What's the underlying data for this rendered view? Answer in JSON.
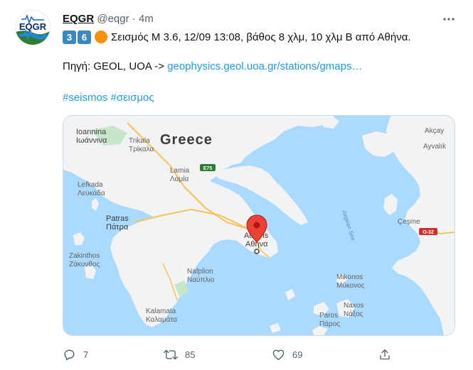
{
  "tweet": {
    "display_name": "EQGR",
    "handle": "@eqgr",
    "separator": "·",
    "time": "4m",
    "avatar_text": "EQGR",
    "keycap_1": "3",
    "keycap_2": "6",
    "text_line1": "Σεισμός M 3.6, 12/09 13:08, βάθος 8 χλμ, 10 χλμ Β από Αθήνα.",
    "source_prefix": "Πηγή: GEOL, UOA -> ",
    "source_link": "geophysics.geol.uoa.gr/stations/gmaps…",
    "hashtags": "#seismos #σεισμος"
  },
  "map": {
    "country_label": "Greece",
    "cities": [
      {
        "name": "Ioannina",
        "local": "Ιωάννινα"
      },
      {
        "name": "Trikala",
        "local": "Τρίκαλα"
      },
      {
        "name": "Lamia",
        "local": "Λαμία"
      },
      {
        "name": "Lefkada",
        "local": "Λευκάδα"
      },
      {
        "name": "Patras",
        "local": "Πάτρα"
      },
      {
        "name": "Zakinthos",
        "local": "Ζάκυνθος"
      },
      {
        "name": "Nafplion",
        "local": "Ναύπλιο"
      },
      {
        "name": "Kalamata",
        "local": "Καλαμάτα"
      },
      {
        "name": "Athens",
        "local": "Αθήνα"
      },
      {
        "name": "Mikonos",
        "local": "Μύκονος"
      },
      {
        "name": "Naxos",
        "local": "Νάξος"
      },
      {
        "name": "Paros",
        "local": "Πάρος"
      },
      {
        "name": "Akçay",
        "local": ""
      },
      {
        "name": "Ayvalık",
        "local": ""
      },
      {
        "name": "Çeşme",
        "local": ""
      }
    ],
    "sea_label": "Aegean Sea",
    "road_labels": [
      "E75",
      "O-32"
    ],
    "pin_color": "#ea4335"
  },
  "actions": {
    "reply_count": "7",
    "retweet_count": "85",
    "like_count": "69"
  },
  "icons": [
    "more-icon",
    "reply-icon",
    "retweet-icon",
    "like-icon",
    "share-icon",
    "map-pin-icon"
  ]
}
